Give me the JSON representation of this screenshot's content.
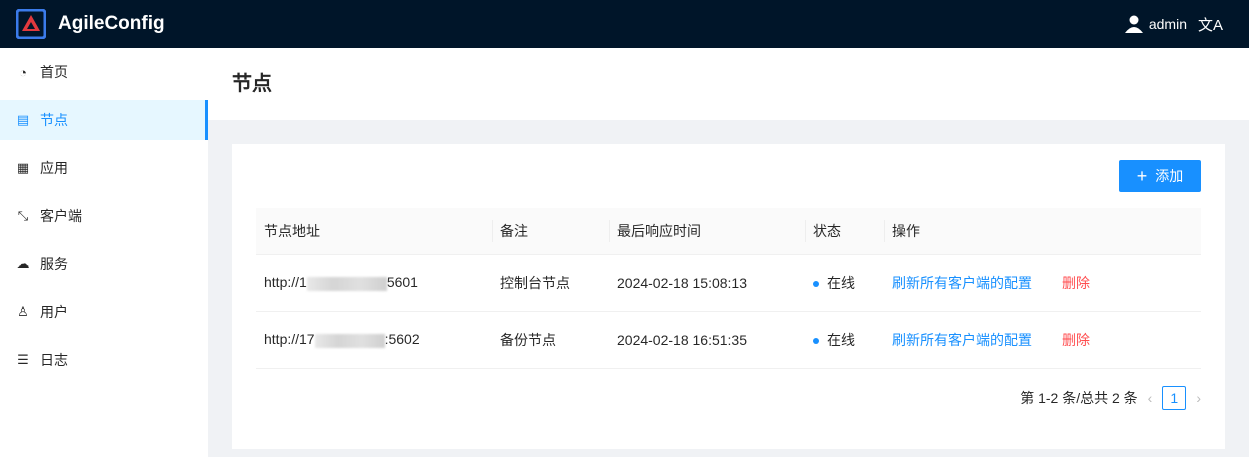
{
  "app": {
    "title": "AgileConfig",
    "user": "admin",
    "lang_icon": "translate-icon"
  },
  "sidebar": {
    "items": [
      {
        "label": "首页",
        "icon": "dashboard-icon"
      },
      {
        "label": "节点",
        "icon": "database-icon",
        "active": true
      },
      {
        "label": "应用",
        "icon": "appstore-icon"
      },
      {
        "label": "客户端",
        "icon": "shrink-icon"
      },
      {
        "label": "服务",
        "icon": "cloud-icon"
      },
      {
        "label": "用户",
        "icon": "user-icon"
      },
      {
        "label": "日志",
        "icon": "list-icon"
      }
    ]
  },
  "page": {
    "title": "节点",
    "add_label": "添加"
  },
  "table": {
    "columns": [
      "节点地址",
      "备注",
      "最后响应时间",
      "状态",
      "操作"
    ],
    "rows": [
      {
        "addr_prefix": "http://1",
        "addr_suffix": "5601",
        "remark": "控制台节点",
        "time": "2024-02-18 15:08:13",
        "status": "在线",
        "action": "刷新所有客户端的配置",
        "delete": "删除"
      },
      {
        "addr_prefix": "http://17",
        "addr_suffix": ":5602",
        "remark": "备份节点",
        "time": "2024-02-18 16:51:35",
        "status": "在线",
        "action": "刷新所有客户端的配置",
        "delete": "删除"
      }
    ]
  },
  "pagination": {
    "summary": "第 1-2 条/总共 2 条",
    "current": "1"
  },
  "colors": {
    "primary": "#1890ff",
    "header": "#001529",
    "danger": "#ff4d4f"
  }
}
